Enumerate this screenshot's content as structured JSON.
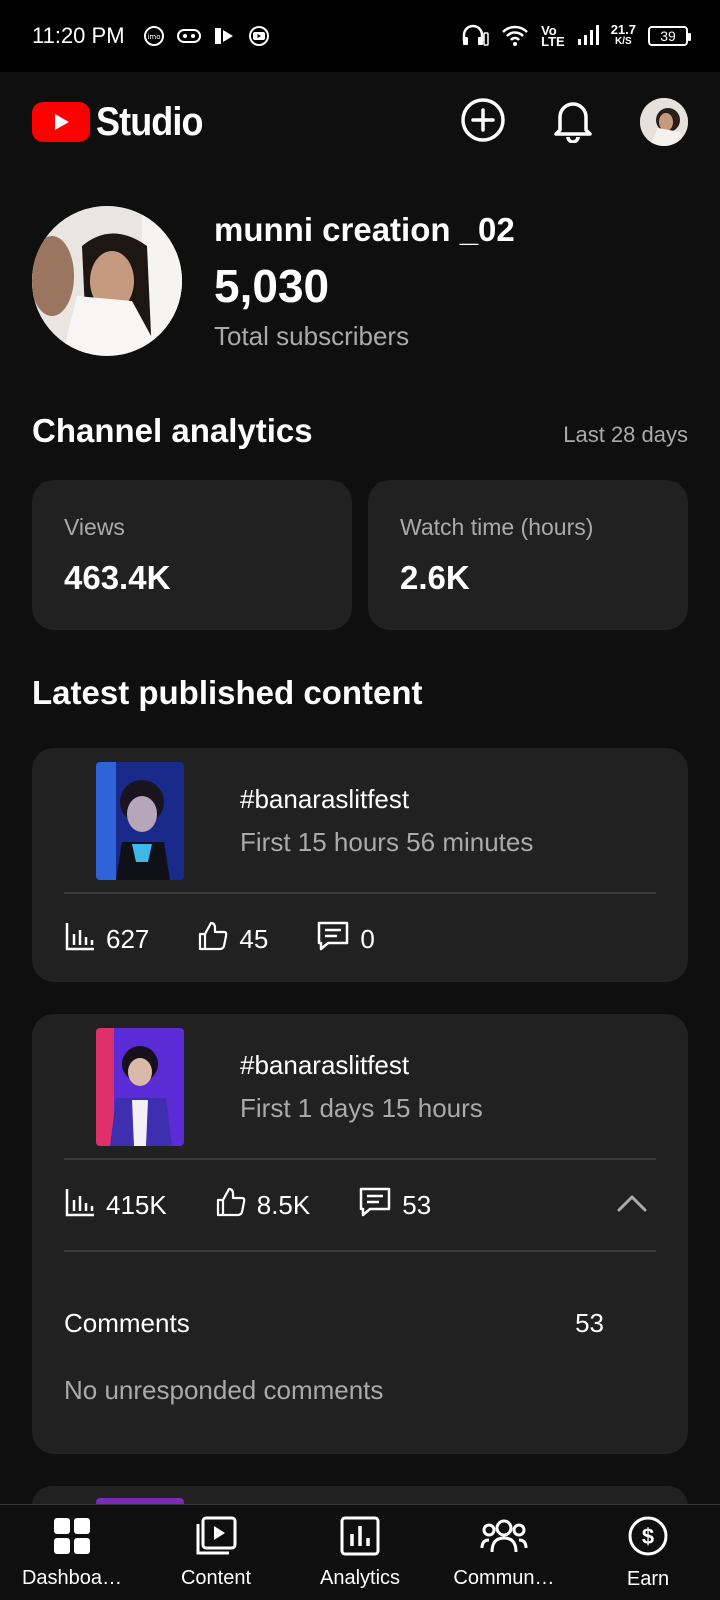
{
  "status_bar": {
    "time": "11:20 PM",
    "speed_value": "21.7",
    "speed_unit": "K/S",
    "battery": "39",
    "volte_top": "Vo",
    "volte_bottom": "LTE"
  },
  "header": {
    "logo_text": "Studio",
    "icons": [
      "create-icon",
      "bell-icon",
      "account-avatar"
    ]
  },
  "channel": {
    "name": "munni creation _02",
    "subscribers": "5,030",
    "subscribers_label": "Total subscribers"
  },
  "analytics": {
    "title": "Channel analytics",
    "period": "Last 28 days",
    "cards": [
      {
        "label": "Views",
        "value": "463.4K"
      },
      {
        "label": "Watch time (hours)",
        "value": "2.6K"
      }
    ]
  },
  "latest": {
    "title": "Latest published content",
    "items": [
      {
        "title": "#banaraslitfest",
        "time": "First 15 hours 56 minutes",
        "views": "627",
        "likes": "45",
        "comments": "0"
      },
      {
        "title": "#banaraslitfest",
        "time": "First 1 days 15 hours",
        "views": "415K",
        "likes": "8.5K",
        "comments": "53",
        "expanded": {
          "comments_label": "Comments",
          "comments_count": "53",
          "note": "No unresponded comments"
        }
      }
    ]
  },
  "nav": {
    "items": [
      {
        "label": "Dashboa…"
      },
      {
        "label": "Content"
      },
      {
        "label": "Analytics"
      },
      {
        "label": "Commun…"
      },
      {
        "label": "Earn"
      }
    ]
  },
  "colors": {
    "background": "#0f0f0f",
    "card": "#212121",
    "brand": "#ff0000",
    "muted": "#aaaaaa"
  }
}
